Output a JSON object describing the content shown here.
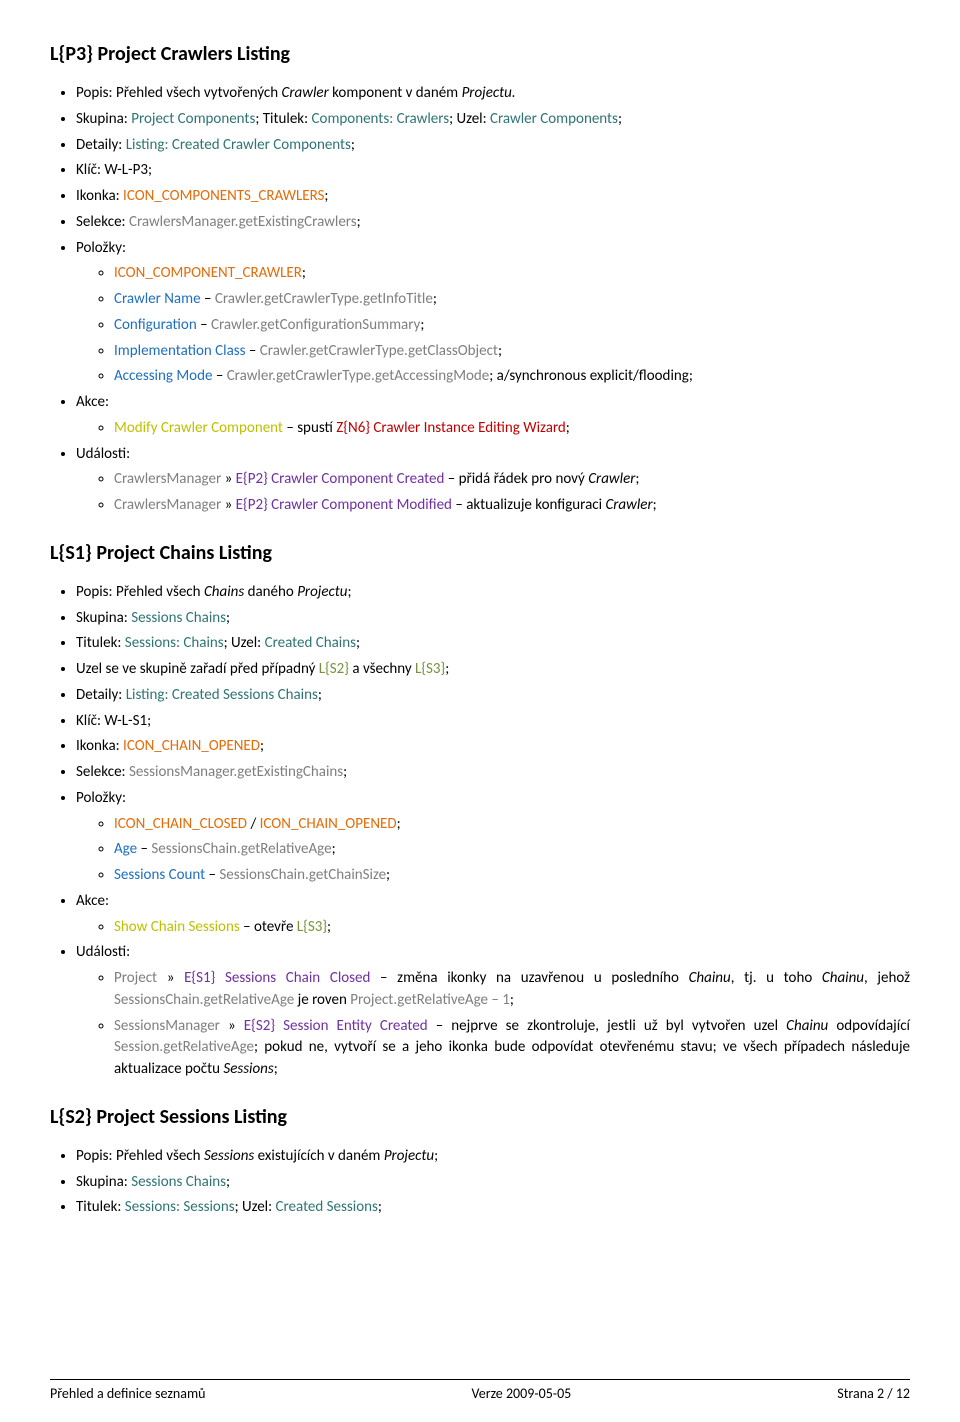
{
  "h1": "L{P3} Project Crawlers Listing",
  "p3": {
    "popis_lbl": "Popis: ",
    "popis_val": "Přehled všech vytvořených ",
    "popis_it1": "Crawler",
    "popis_val2": " komponent v daném ",
    "popis_it2": "Projectu.",
    "skup_lbl": "Skupina: ",
    "skup_a": "Project Components",
    "skup_sep1": "; Titulek: ",
    "skup_b": "Components: Crawlers",
    "skup_sep2": "; Uzel: ",
    "skup_c": "Crawler Components",
    "skup_end": ";",
    "det_lbl": "Detaily: ",
    "det_v": "Listing: Created Crawler Components",
    "det_end": ";",
    "klic": "Klíč: W-L-P3;",
    "ik_lbl": "Ikonka: ",
    "ik_v": "ICON_COMPONENTS_CRAWLERS",
    "ik_end": ";",
    "sel_lbl": "Selekce: ",
    "sel_v": "CrawlersManager.getExistingCrawlers",
    "sel_end": ";",
    "pol": "Položky:",
    "pol_a": "ICON_COMPONENT_CRAWLER",
    "pol_a_end": ";",
    "pol_b1": "Crawler Name",
    "pol_b_dash": " – ",
    "pol_b2": "Crawler.getCrawlerType.getInfoTitle",
    "pol_b_end": ";",
    "pol_c1": "Configuration",
    "pol_c2": "Crawler.getConfigurationSummary",
    "pol_c_end": ";",
    "pol_d1": "Implementation Class",
    "pol_d2": "Crawler.getCrawlerType.getClassObject",
    "pol_d_end": ";",
    "pol_e1": "Accessing Mode",
    "pol_e2": "Crawler.getCrawlerType.getAccessingMode",
    "pol_e3": "; a/synchronous explicit/flooding;",
    "akce": "Akce:",
    "ak_a1": "Modify Crawler Component",
    "ak_a2": " – spustí ",
    "ak_a3": "Z{N6} Crawler Instance Editing Wizard",
    "ak_a_end": ";",
    "ud": "Události:",
    "ud_a1": "CrawlersManager",
    "ud_a_sep": " » ",
    "ud_a2": "E{P2} Crawler Component Created",
    "ud_a3": " – přidá řádek pro nový ",
    "ud_a4": "Crawler",
    "ud_a_end": ";",
    "ud_b1": "CrawlersManager",
    "ud_b2": "E{P2} Crawler Component Modified",
    "ud_b3": " – aktualizuje konfiguraci ",
    "ud_b4": "Crawler",
    "ud_b_end": ";"
  },
  "h2": "L{S1} Project Chains Listing",
  "s1": {
    "popis_lbl": "Popis: ",
    "popis_val": "Přehled všech ",
    "popis_it1": "Chains",
    "popis_val2": " daného ",
    "popis_it2": "Projectu",
    "popis_end": ";",
    "skup_lbl": "Skupina: ",
    "skup_v": "Sessions Chains",
    "skup_end": ";",
    "tit_lbl": "Titulek: ",
    "tit_a": "Sessions: Chains",
    "tit_sep": "; Uzel: ",
    "tit_b": "Created Chains",
    "tit_end": ";",
    "uzel": "Uzel se ve skupině zařadí před případný ",
    "uzel_a": "L{S2}",
    "uzel_mid": " a všechny ",
    "uzel_b": "L{S3}",
    "uzel_end": ";",
    "det_lbl": "Detaily: ",
    "det_v": "Listing: Created Sessions Chains",
    "det_end": ";",
    "klic": "Klíč: W-L-S1;",
    "ik_lbl": "Ikonka: ",
    "ik_v": "ICON_CHAIN_OPENED",
    "ik_end": ";",
    "sel_lbl": "Selekce: ",
    "sel_v": "SessionsManager.getExistingChains",
    "sel_end": ";",
    "pol": "Položky:",
    "pol_a1": "ICON_CHAIN_CLOSED",
    "pol_a_sep": " / ",
    "pol_a2": "ICON_CHAIN_OPENED",
    "pol_a_end": ";",
    "pol_b1": "Age",
    "pol_b_dash": " – ",
    "pol_b2": "SessionsChain.getRelativeAge",
    "pol_b_end": ";",
    "pol_c1": "Sessions Count",
    "pol_c2": "SessionsChain.getChainSize",
    "pol_c_end": ";",
    "akce": "Akce:",
    "ak_a1": "Show Chain Sessions",
    "ak_a2": " – otevře ",
    "ak_a3": "L{S3}",
    "ak_a_end": ";",
    "ud": "Události:",
    "ud_a1": "Project",
    "ud_a_sep": " » ",
    "ud_a2": "E{S1} Sessions Chain Closed",
    "ud_a3": " – změna ikonky na uzavřenou u posledního ",
    "ud_a4": "Chainu",
    "ud_a5": ", tj. u toho ",
    "ud_a6": "Chainu",
    "ud_a7": ", jehož ",
    "ud_a8": "SessionsChain.getRelativeAge",
    "ud_a9": " je roven ",
    "ud_a10": "Project.getRelativeAge – 1",
    "ud_a_end": ";",
    "ud_b1": "SessionsManager",
    "ud_b2": "E{S2} Session Entity Created",
    "ud_b3": " – nejprve se zkontroluje, jestli už byl vytvořen uzel ",
    "ud_b4": "Chainu",
    "ud_b5": " odpovídající ",
    "ud_b6": "Session.getRelativeAge",
    "ud_b7": "; pokud ne, vytvoří se a jeho ikonka bude odpovídat otevřenému stavu; ve všech případech následuje aktualizace počtu ",
    "ud_b8": "Sessions",
    "ud_b_end": ";"
  },
  "h3": "L{S2} Project Sessions Listing",
  "s2": {
    "popis_lbl": "Popis: ",
    "popis_val": "Přehled všech ",
    "popis_it1": "Sessions",
    "popis_val2": " existujících v daném ",
    "popis_it2": "Projectu",
    "popis_end": ";",
    "skup_lbl": "Skupina: ",
    "skup_v": "Sessions Chains",
    "skup_end": ";",
    "tit_lbl": "Titulek: ",
    "tit_a": "Sessions: Sessions",
    "tit_sep": "; Uzel: ",
    "tit_b": "Created Sessions",
    "tit_end": ";"
  },
  "footer": {
    "left": "Přehled a definice seznamů",
    "center": "Verze 2009-05-05",
    "right": "Strana 2 / 12"
  }
}
